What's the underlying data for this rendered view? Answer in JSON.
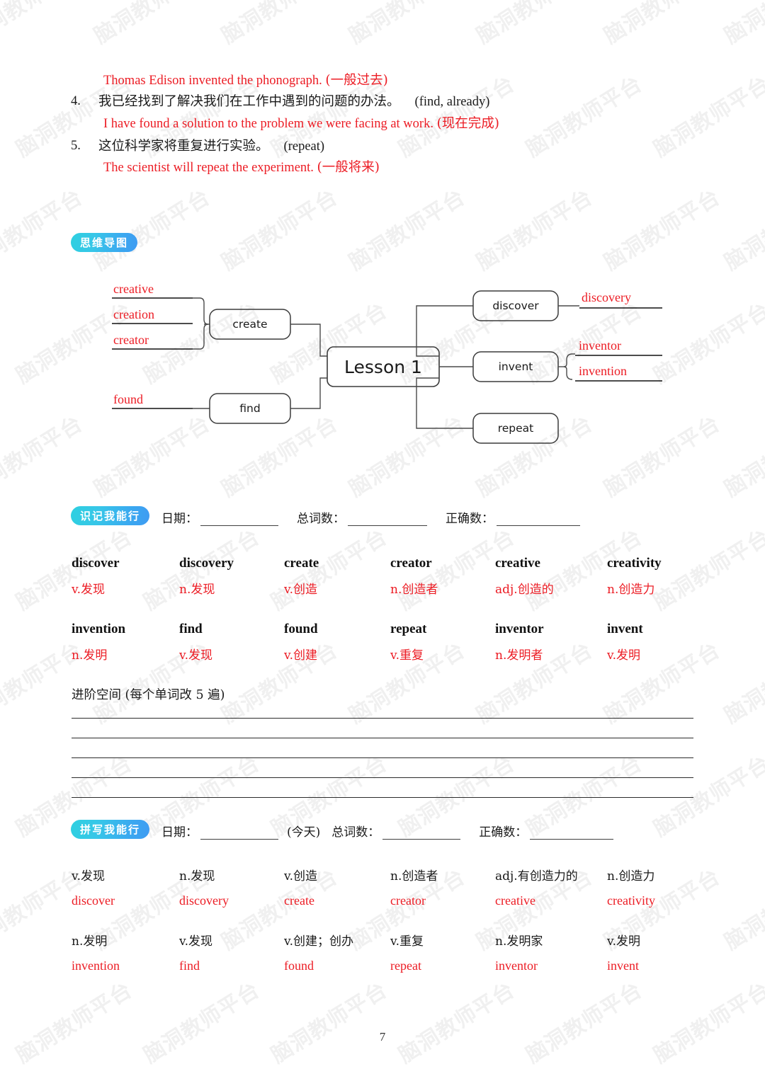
{
  "page": {
    "number": "7",
    "watermark_text": "脑洞教师平台"
  },
  "translation_exercises": {
    "items": [
      {
        "answer": "Thomas Edison invented the phonograph.",
        "tense": "(一般过去)"
      },
      {
        "number": "4.",
        "prompt": "我已经找到了解决我们在工作中遇到的问题的办法。",
        "hint": "(find, already)",
        "answer": "I have found a solution to the problem we were facing at work.",
        "tense": "(现在完成)"
      },
      {
        "number": "5.",
        "prompt": "这位科学家将重复进行实验。",
        "hint": "(repeat)",
        "answer": "The scientist will repeat the experiment.",
        "tense": "(一般将来)"
      }
    ]
  },
  "mindmap": {
    "badge": "思维导图",
    "center": "Lesson 1",
    "left_nodes": [
      {
        "label": "create",
        "derivatives": [
          "creative",
          "creation",
          "creator"
        ]
      },
      {
        "label": "find",
        "derivatives": [
          "found"
        ]
      }
    ],
    "right_nodes": [
      {
        "label": "discover",
        "derivatives": [
          "discovery"
        ]
      },
      {
        "label": "invent",
        "derivatives": [
          "inventor",
          "invention"
        ]
      },
      {
        "label": "repeat",
        "derivatives": []
      }
    ]
  },
  "recognition_section": {
    "badge": "识记我能行",
    "meta": {
      "date_label": "日期：",
      "total_label": "总词数：",
      "correct_label": "正确数："
    },
    "rows": [
      [
        {
          "word": "discover",
          "meaning": "v.发现"
        },
        {
          "word": "discovery",
          "meaning": "n.发现"
        },
        {
          "word": "create",
          "meaning": "v.创造"
        },
        {
          "word": "creator",
          "meaning": "n.创造者"
        },
        {
          "word": "creative",
          "meaning": "adj.创造的"
        },
        {
          "word": "creativity",
          "meaning": "n.创造力"
        }
      ],
      [
        {
          "word": "invention",
          "meaning": "n.发明"
        },
        {
          "word": "find",
          "meaning": "v.发现"
        },
        {
          "word": "found",
          "meaning": "v.创建"
        },
        {
          "word": "repeat",
          "meaning": "v.重复"
        },
        {
          "word": "inventor",
          "meaning": "n.发明者"
        },
        {
          "word": "invent",
          "meaning": "v.发明"
        }
      ]
    ]
  },
  "advanced_section": {
    "title": "进阶空间 (每个单词改 5 遍)",
    "rule_count": 5
  },
  "spelling_section": {
    "badge": "拼写我能行",
    "meta": {
      "date_label": "日期：",
      "today_label": "(今天)",
      "total_label": "总词数：",
      "correct_label": "正确数："
    },
    "rows": [
      [
        {
          "meaning": "v.发现",
          "word": "discover"
        },
        {
          "meaning": "n.发现",
          "word": "discovery"
        },
        {
          "meaning": "v.创造",
          "word": "create"
        },
        {
          "meaning": "n.创造者",
          "word": "creator"
        },
        {
          "meaning": "adj.有创造力的",
          "word": "creative"
        },
        {
          "meaning": "n.创造力",
          "word": "creativity"
        }
      ],
      [
        {
          "meaning": "n.发明",
          "word": "invention"
        },
        {
          "meaning": "v.发现",
          "word": "find"
        },
        {
          "meaning": "v.创建；创办",
          "word": "found"
        },
        {
          "meaning": "v.重复",
          "word": "repeat"
        },
        {
          "meaning": "n.发明家",
          "word": "inventor"
        },
        {
          "meaning": "v.发明",
          "word": "invent"
        }
      ]
    ]
  },
  "colors": {
    "answer_red": "#ec1c24",
    "badge_cyan": "#2ed0e0",
    "badge_blue": "#3f9bf2",
    "ink": "#1a1a1a"
  }
}
